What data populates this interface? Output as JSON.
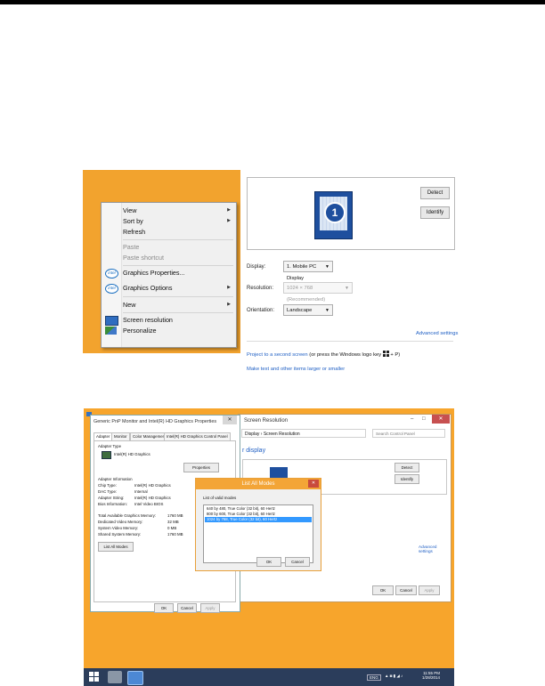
{
  "context_menu": {
    "items": [
      {
        "label": "View",
        "submenu": true
      },
      {
        "label": "Sort by",
        "submenu": true
      },
      {
        "label": "Refresh"
      },
      {
        "label": "Paste",
        "disabled": true
      },
      {
        "label": "Paste shortcut",
        "disabled": true
      },
      {
        "label": "Graphics Properties..."
      },
      {
        "label": "Graphics Options",
        "submenu": true
      },
      {
        "label": "New",
        "submenu": true
      },
      {
        "label": "Screen resolution"
      },
      {
        "label": "Personalize"
      }
    ],
    "submenu_glyph": "▶",
    "intel_badge": "intel"
  },
  "display_panel": {
    "monitor_number": "1",
    "detect_label": "Detect",
    "identify_label": "Identify",
    "display_label": "Display:",
    "display_value": "1. Mobile PC Display",
    "resolution_label": "Resolution:",
    "resolution_value": "1024 × 768 (Recommended)",
    "orientation_label": "Orientation:",
    "orientation_value": "Landscape",
    "advanced_link": "Advanced settings",
    "project_link": "Project to a second screen",
    "project_suffix": "(or press the Windows logo key",
    "project_end": "+ P)",
    "text_size_link": "Make text and other items larger or smaller"
  },
  "screenshot": {
    "screen_res": {
      "title": "Screen Resolution",
      "address": "Display  ›  Screen Resolution",
      "search_placeholder": "Search Control Panel",
      "heading": "r display",
      "detect": "Detect",
      "identify": "Identify",
      "advanced": "Advanced settings",
      "ok": "OK",
      "cancel": "Cancel",
      "apply": "Apply"
    },
    "graphics_props": {
      "title": "Generic PnP Monitor and Intel(R) HD Graphics Properties",
      "tabs": [
        "Adapter",
        "Monitor",
        "Color Management",
        "Intel(R) HD Graphics Control Panel"
      ],
      "adapter_type_label": "Adapter Type",
      "adapter_name": "Intel(R) HD Graphics",
      "properties": "Properties",
      "info_label": "Adapter Information",
      "rows": [
        {
          "k": "Chip Type:",
          "v": "Intel(R) HD Graphics"
        },
        {
          "k": "DAC Type:",
          "v": "Internal"
        },
        {
          "k": "Adapter String:",
          "v": "Intel(R) HD Graphics"
        },
        {
          "k": "Bios Information:",
          "v": "Intel Video BIOS"
        }
      ],
      "mem_rows": [
        {
          "k": "Total Available Graphics Memory:",
          "v": "1760 MB"
        },
        {
          "k": "Dedicated Video Memory:",
          "v": "32 MB"
        },
        {
          "k": "System Video Memory:",
          "v": "0 MB"
        },
        {
          "k": "Shared System Memory:",
          "v": "1760 MB"
        }
      ],
      "list_all_modes": "List All Modes",
      "ok": "OK",
      "cancel": "Cancel",
      "apply": "Apply"
    },
    "list_modes": {
      "title": "List All Modes",
      "caption": "List of valid modes",
      "modes": [
        "640 by 480, True Color (32 bit), 60 Hertz",
        "800 by 600, True Color (32 bit), 60 Hertz",
        "1024 by 768, True Color (32 bit), 60 Hertz"
      ],
      "selected_index": 2,
      "ok": "OK",
      "cancel": "Cancel"
    },
    "taskbar": {
      "clock_time": "11:55 PM",
      "clock_date": "1/28/2014",
      "lang": "ENG"
    }
  }
}
